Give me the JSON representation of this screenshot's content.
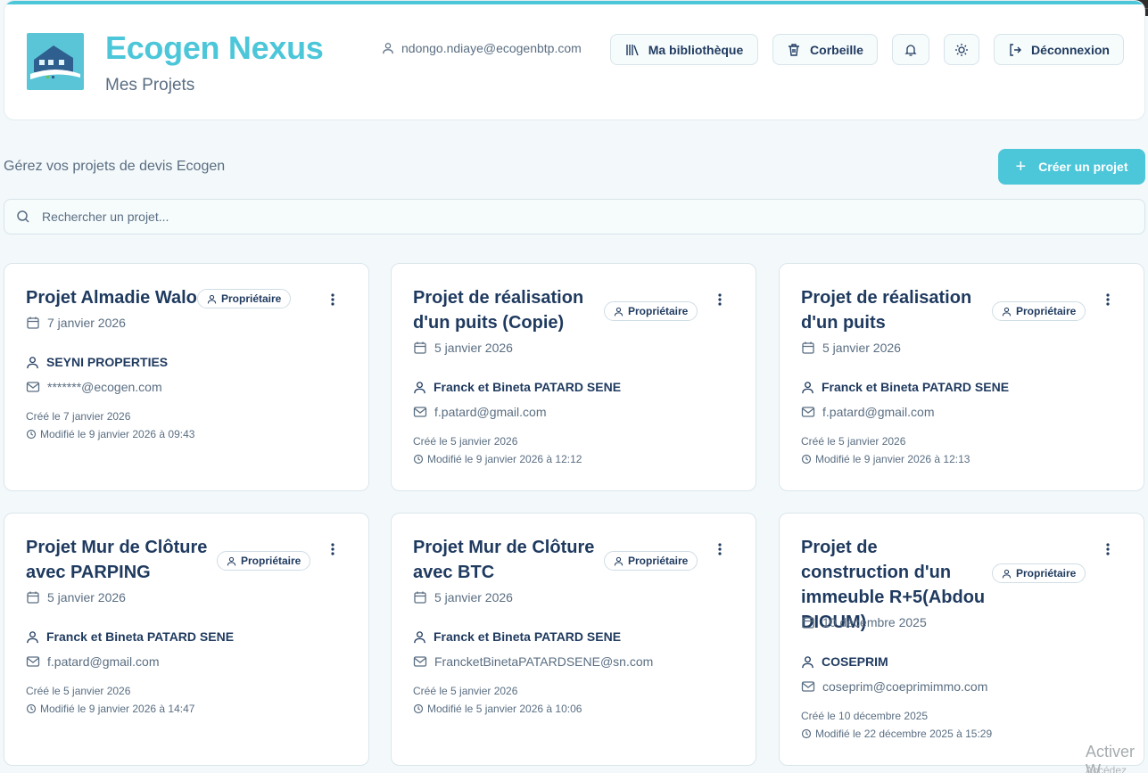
{
  "header": {
    "app_title": "Ecogen Nexus",
    "app_subtitle": "Mes Projets",
    "user_email": "ndongo.ndiaye@ecogenbtp.com",
    "library_label": "Ma bibliothèque",
    "trash_label": "Corbeille",
    "logout_label": "Déconnexion"
  },
  "page": {
    "subtitle": "Gérez vos projets de devis Ecogen",
    "create_label": "Créer un projet",
    "search_placeholder": "Rechercher un projet..."
  },
  "colors": {
    "accent": "#4cc6d9",
    "text": "#1f3a5f",
    "muted": "#5a6e82"
  },
  "projects": [
    {
      "title": "Projet Almadie Walo",
      "badge": "Propriétaire",
      "date": "7 janvier 2026",
      "client": "SEYNI PROPERTIES",
      "email": "*******@ecogen.com",
      "created": "Créé le 7 janvier 2026",
      "modified": "Modifié le 9 janvier 2026 à 09:43"
    },
    {
      "title": "Projet de réalisation d'un puits (Copie)",
      "badge": "Propriétaire",
      "date": "5 janvier 2026",
      "client": "Franck et Bineta PATARD SENE",
      "email": "f.patard@gmail.com",
      "created": "Créé le 5 janvier 2026",
      "modified": "Modifié le 9 janvier 2026 à 12:12"
    },
    {
      "title": "Projet de réalisation d'un puits",
      "badge": "Propriétaire",
      "date": "5 janvier 2026",
      "client": "Franck et Bineta PATARD SENE",
      "email": "f.patard@gmail.com",
      "created": "Créé le 5 janvier 2026",
      "modified": "Modifié le 9 janvier 2026 à 12:13"
    },
    {
      "title": "Projet Mur de Clôture avec PARPING",
      "badge": "Propriétaire",
      "date": "5 janvier 2026",
      "client": "Franck et Bineta PATARD SENE",
      "email": "f.patard@gmail.com",
      "created": "Créé le 5 janvier 2026",
      "modified": "Modifié le 9 janvier 2026 à 14:47"
    },
    {
      "title": "Projet Mur de Clôture avec BTC",
      "badge": "Propriétaire",
      "date": "5 janvier 2026",
      "client": "Franck et Bineta PATARD SENE",
      "email": "FrancketBinetaPATARDSENE@sn.com",
      "created": "Créé le 5 janvier 2026",
      "modified": "Modifié le 5 janvier 2026 à 10:06"
    },
    {
      "title": "Projet de construction d'un immeuble R+5(Abdou DIOUM)",
      "badge": "Propriétaire",
      "date": "10 décembre 2025",
      "client": "COSEPRIM",
      "email": "coseprim@coeprimimmo.com",
      "created": "Créé le 10 décembre 2025",
      "modified": "Modifié le 22 décembre 2025 à 15:29"
    }
  ],
  "watermark": {
    "line1": "Activer W",
    "line2": "Accédez"
  }
}
